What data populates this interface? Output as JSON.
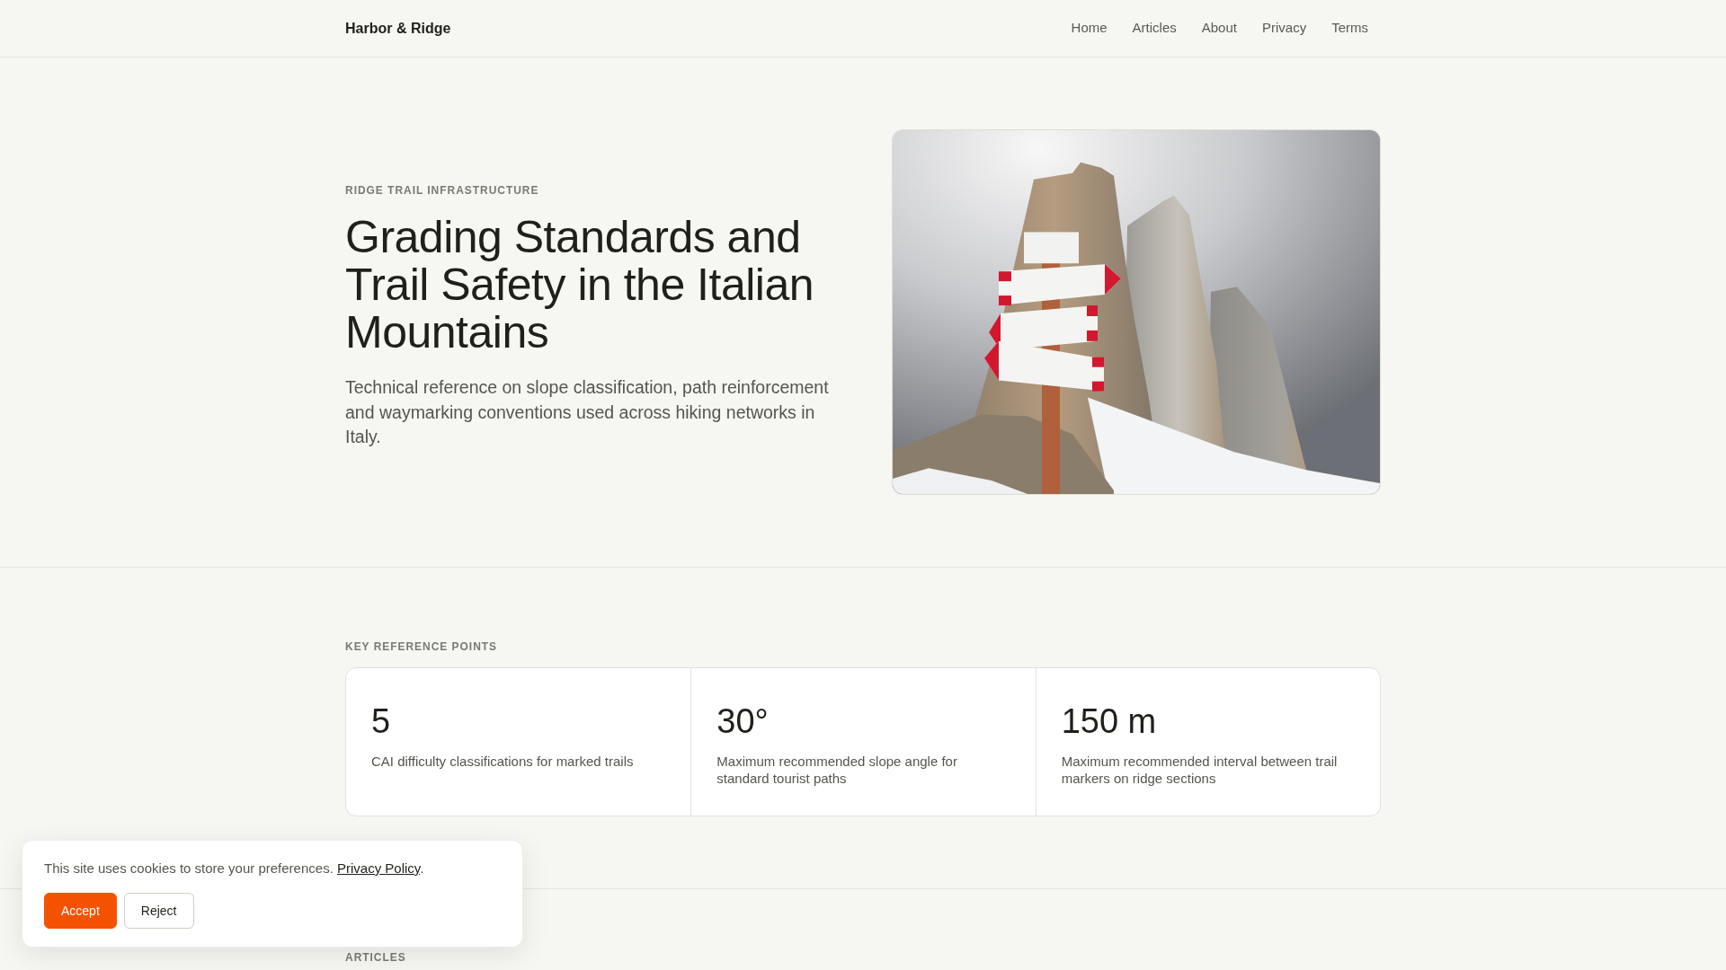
{
  "header": {
    "brand": "Harbor & Ridge",
    "nav": [
      {
        "label": "Home"
      },
      {
        "label": "Articles"
      },
      {
        "label": "About"
      },
      {
        "label": "Privacy"
      },
      {
        "label": "Terms"
      }
    ]
  },
  "hero": {
    "eyebrow": "RIDGE TRAIL INFRASTRUCTURE",
    "title": "Grading Standards and Trail Safety in the Italian Mountains",
    "lead": "Technical reference on slope classification, path reinforcement and waymarking conventions used across hiking networks in Italy."
  },
  "reference": {
    "eyebrow": "KEY REFERENCE POINTS",
    "stats": [
      {
        "value": "5",
        "caption": "CAI difficulty classifications for marked trails"
      },
      {
        "value": "30°",
        "caption": "Maximum recommended slope angle for standard tourist paths"
      },
      {
        "value": "150 m",
        "caption": "Maximum recommended interval between trail markers on ridge sections"
      }
    ]
  },
  "articles": {
    "eyebrow": "ARTICLES"
  },
  "cookie_banner": {
    "text": "This site uses cookies to store your preferences.",
    "link": "Privacy Policy",
    "text_after": ".",
    "buttons": [
      {
        "label": "Accept",
        "kind": "primary"
      },
      {
        "label": "Reject",
        "kind": "secondary"
      }
    ]
  }
}
